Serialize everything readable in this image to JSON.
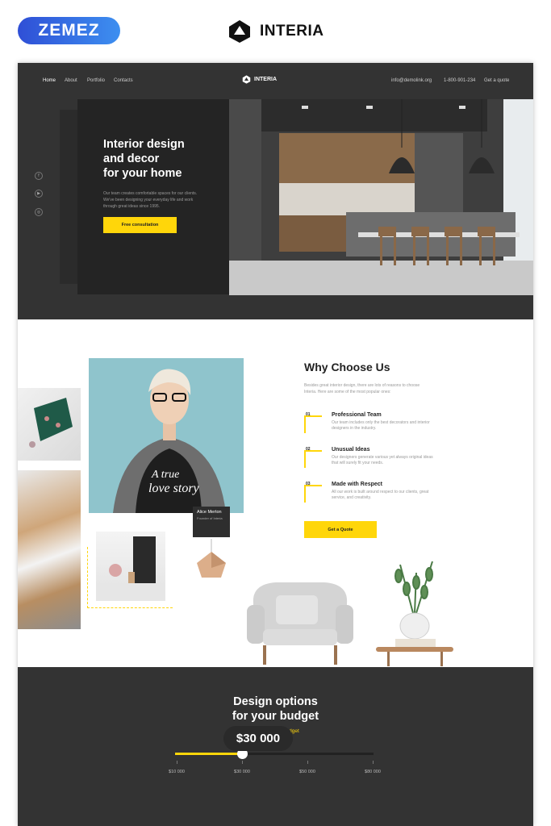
{
  "header": {
    "zemez_logo": "ZEMEZ",
    "brand": "INTERIA"
  },
  "site": {
    "nav": [
      {
        "label": "Home",
        "active": true
      },
      {
        "label": "About",
        "active": false
      },
      {
        "label": "Portfolio",
        "active": false
      },
      {
        "label": "Contacts",
        "active": false
      }
    ],
    "logo": "INTERIA",
    "email": "info@demolink.org",
    "phone": "1-800-901-234",
    "quote_link": "Get a quote"
  },
  "hero": {
    "title_lines": [
      "Interior design",
      "and decor",
      "for your home"
    ],
    "text": "Our team creates comfortable spaces for our clients. We've been designing your everyday life and work through great ideas since 1995.",
    "button": "Free consultation",
    "social": [
      "facebook-icon",
      "youtube-icon",
      "instagram-icon"
    ]
  },
  "why": {
    "title": "Why Choose Us",
    "intro": "Besides great interior design, there are lots of reasons to choose Interia. Here are some of the most popular ones:",
    "features": [
      {
        "num": "01",
        "title": "Professional Team",
        "text": "Our team includes only the best decorators and interior designers in the industry.",
        "icon": "team-icon"
      },
      {
        "num": "02",
        "title": "Unusual Ideas",
        "text": "Our designers generate various yet always original ideas that will surely fit your needs.",
        "icon": "lightbulb-icon"
      },
      {
        "num": "03",
        "title": "Made with Respect",
        "text": "All our work is built around respect to our clients, great service, and creativity.",
        "icon": "heart-icon"
      }
    ],
    "button": "Get a Quote",
    "person_name": "Alice Merton",
    "person_role": "Founder of Interia"
  },
  "budget": {
    "title_lines": [
      "Design options",
      "for your budget"
    ],
    "subtitle": "Choose your budget",
    "ticks": [
      "$10 000",
      "$30 000",
      "$50 000",
      "$80 000"
    ],
    "selected": 0.34,
    "price": "$30 000"
  },
  "colors": {
    "accent": "#ffd60a",
    "dark": "#333333",
    "zemez_blue": "#3a6ee8"
  }
}
